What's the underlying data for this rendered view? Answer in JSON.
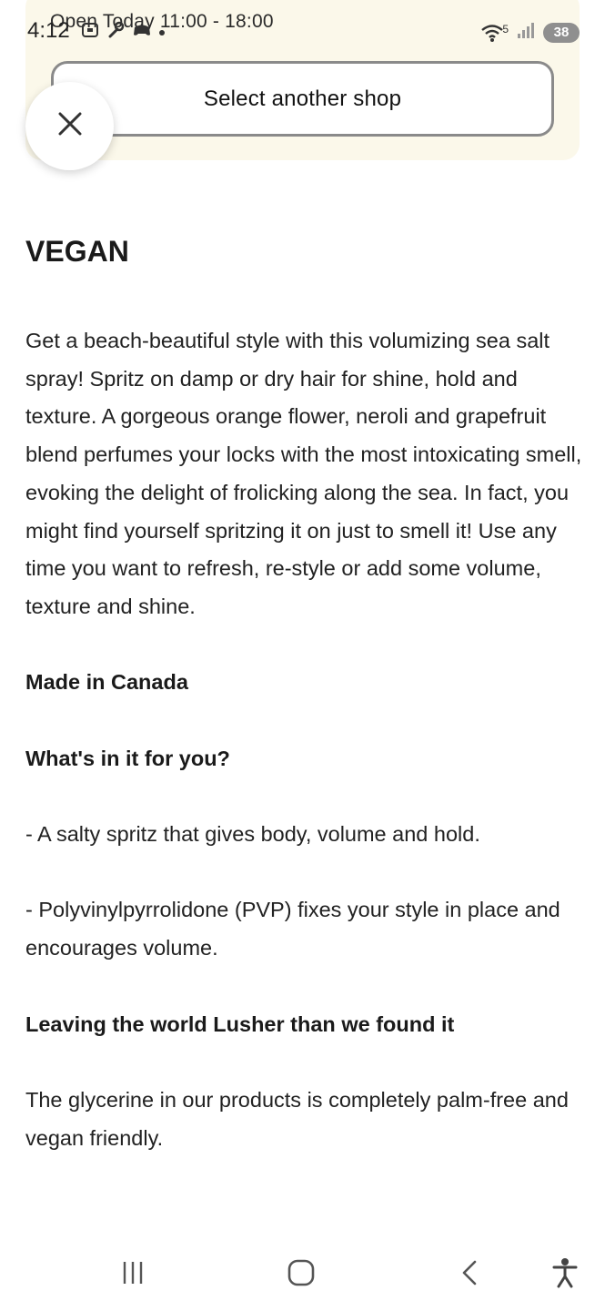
{
  "status_bar": {
    "time": "4:12",
    "network_indicator": "5",
    "battery": "38"
  },
  "shop": {
    "hours": "Open Today 11:00 - 18:00",
    "select_label": "Select another shop"
  },
  "product": {
    "heading": "VEGAN",
    "description": "Get a beach-beautiful style with this volumizing sea salt spray! Spritz on damp or dry hair for shine, hold and texture. A gorgeous orange flower, neroli and grapefruit blend perfumes your locks with the most intoxicating smell, evoking the delight of frolicking along the sea. In fact, you might find yourself spritzing it on just to smell it! Use any time you want to refresh, re-style or add some volume, texture and shine.",
    "made_in": "Made in Canada",
    "whats_in_heading": "What's in it for you?",
    "benefit_1": "- A salty spritz that gives body, volume and hold.",
    "benefit_2": "- Polyvinylpyrrolidone (PVP) fixes your style in place and encourages volume.",
    "lusher_heading": "Leaving the world Lusher than we found it",
    "glycerine": "The glycerine in our products is completely palm-free and vegan friendly."
  },
  "nav": {
    "recents_icon": "recent-apps-icon",
    "home_icon": "home-icon",
    "back_icon": "back-icon",
    "accessibility_icon": "accessibility-icon"
  }
}
